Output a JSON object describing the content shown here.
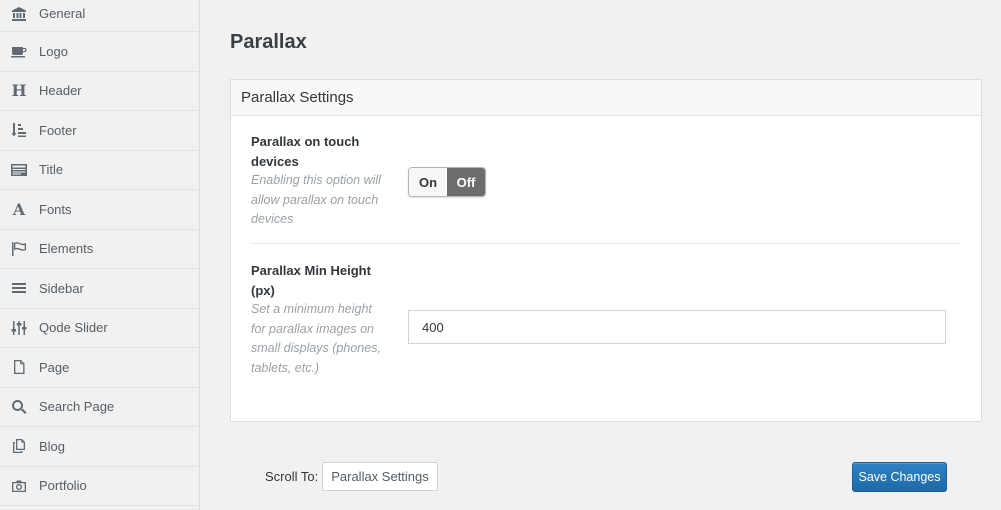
{
  "sidebar": {
    "items": [
      {
        "label": "General",
        "icon": "bank-icon"
      },
      {
        "label": "Logo",
        "icon": "coffee-cup-icon"
      },
      {
        "label": "Header",
        "icon": "heading-icon"
      },
      {
        "label": "Footer",
        "icon": "sort-list-icon"
      },
      {
        "label": "Title",
        "icon": "title-bar-icon"
      },
      {
        "label": "Fonts",
        "icon": "font-icon"
      },
      {
        "label": "Elements",
        "icon": "flag-icon"
      },
      {
        "label": "Sidebar",
        "icon": "menu-lines-icon"
      },
      {
        "label": "Qode Slider",
        "icon": "sliders-icon"
      },
      {
        "label": "Page",
        "icon": "page-icon"
      },
      {
        "label": "Search Page",
        "icon": "search-icon"
      },
      {
        "label": "Blog",
        "icon": "copy-icon"
      },
      {
        "label": "Portfolio",
        "icon": "camera-icon"
      }
    ]
  },
  "page": {
    "title": "Parallax"
  },
  "panel": {
    "header": "Parallax Settings",
    "touch": {
      "title": "Parallax on touch devices",
      "description": "Enabling this option will allow parallax on touch devices",
      "on_label": "On",
      "off_label": "Off",
      "value": "Off"
    },
    "min_height": {
      "title": "Parallax Min Height (px)",
      "description": "Set a minimum height for parallax images on small displays (phones, tablets, etc.)",
      "value": "400"
    }
  },
  "footer": {
    "scroll_label": "Scroll To:",
    "scroll_value": "Parallax Settings",
    "save_label": "Save Changes"
  },
  "colors": {
    "accent": "#2271b1",
    "toggle_active": "#6d6d6d"
  }
}
